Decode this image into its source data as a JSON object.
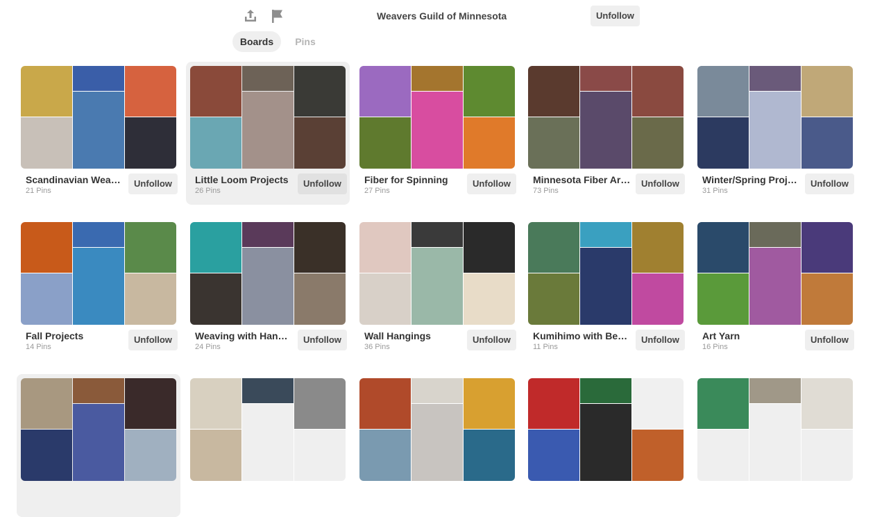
{
  "header": {
    "profile_name": "Weavers Guild of Minnesota",
    "unfollow_label": "Unfollow",
    "share_icon": "share-icon",
    "flag_icon": "flag-icon"
  },
  "tabs": [
    {
      "label": "Boards",
      "active": true
    },
    {
      "label": "Pins",
      "active": false
    }
  ],
  "boards": [
    {
      "title": "Scandinavian Weaving",
      "count": "21 Pins",
      "unfollow": "Unfollow",
      "colors": [
        "#c9a84a",
        "#3a5ea8",
        "#d6623f",
        "#c8c0b8",
        "#4a7ab0",
        "#2e2e38"
      ]
    },
    {
      "title": "Little Loom Projects",
      "count": "26 Pins",
      "unfollow": "Unfollow",
      "colors": [
        "#8a4a3a",
        "#6d6257",
        "#3a3a36",
        "#6aa7b3",
        "#a3918a",
        "#5a4035"
      ]
    },
    {
      "title": "Fiber for Spinning",
      "count": "27 Pins",
      "unfollow": "Unfollow",
      "colors": [
        "#9b6ac0",
        "#a4752e",
        "#5e8a30",
        "#5f7a2e",
        "#d84da0",
        "#e07a2a"
      ]
    },
    {
      "title": "Minnesota Fiber Artists",
      "count": "73 Pins",
      "unfollow": "Unfollow",
      "colors": [
        "#5a3a2e",
        "#8a4a48",
        "#8a4a40",
        "#6a7058",
        "#5a4a6a",
        "#6a6a4a"
      ]
    },
    {
      "title": "Winter/Spring Projects",
      "count": "31 Pins",
      "unfollow": "Unfollow",
      "colors": [
        "#7a8a9a",
        "#6a5a7a",
        "#c0a878",
        "#2c3a60",
        "#b0b8d0",
        "#4a5a8a"
      ]
    },
    {
      "title": "Fall Projects",
      "count": "14 Pins",
      "unfollow": "Unfollow",
      "colors": [
        "#c85a1a",
        "#3a6ab0",
        "#5a8a4a",
        "#8aa0c8",
        "#3a8ac0",
        "#c8b8a0"
      ]
    },
    {
      "title": "Weaving with Handspun",
      "count": "24 Pins",
      "unfollow": "Unfollow",
      "colors": [
        "#2aa0a0",
        "#5a3a5a",
        "#3a3028",
        "#3a3430",
        "#8a90a0",
        "#8a7a6a"
      ]
    },
    {
      "title": "Wall Hangings",
      "count": "36 Pins",
      "unfollow": "Unfollow",
      "colors": [
        "#e0c8c0",
        "#3a3a3a",
        "#2a2a2a",
        "#d8d0c8",
        "#9ab8a8",
        "#e8dcc8"
      ]
    },
    {
      "title": "Kumihimo with Beads",
      "count": "11 Pins",
      "unfollow": "Unfollow",
      "colors": [
        "#4a7a5a",
        "#3aa0c0",
        "#a08030",
        "#6a7a3a",
        "#2a3a6a",
        "#c04aa0"
      ]
    },
    {
      "title": "Art Yarn",
      "count": "16 Pins",
      "unfollow": "Unfollow",
      "colors": [
        "#2a4a6a",
        "#6a6a5a",
        "#4a3a7a",
        "#5a9a3a",
        "#a05aa0",
        "#c07a3a"
      ]
    },
    {
      "title": "",
      "count": "",
      "unfollow": "",
      "colors": [
        "#a89880",
        "#8a5a3a",
        "#3a2a2a",
        "#2a3a6a",
        "#4a5aa0",
        "#a0b0c0"
      ]
    },
    {
      "title": "",
      "count": "",
      "unfollow": "",
      "colors": [
        "#d8d0c0",
        "#3a4a5a",
        "#8a8a8a",
        "#c8b8a0",
        "#efefef",
        "#efefef"
      ]
    },
    {
      "title": "",
      "count": "",
      "unfollow": "",
      "colors": [
        "#b04a2a",
        "#d8d4cc",
        "#d8a030",
        "#7a9ab0",
        "#c8c4c0",
        "#2a6a8a"
      ]
    },
    {
      "title": "",
      "count": "",
      "unfollow": "",
      "colors": [
        "#c02a2a",
        "#2a6a3a",
        "#f0f0f0",
        "#3a5ab0",
        "#2a2a2a",
        "#c0602a"
      ]
    },
    {
      "title": "",
      "count": "",
      "unfollow": "",
      "colors": [
        "#3a8a5a",
        "#a09888",
        "#e0dcd4",
        "#efefef",
        "#efefef",
        "#efefef"
      ]
    }
  ]
}
